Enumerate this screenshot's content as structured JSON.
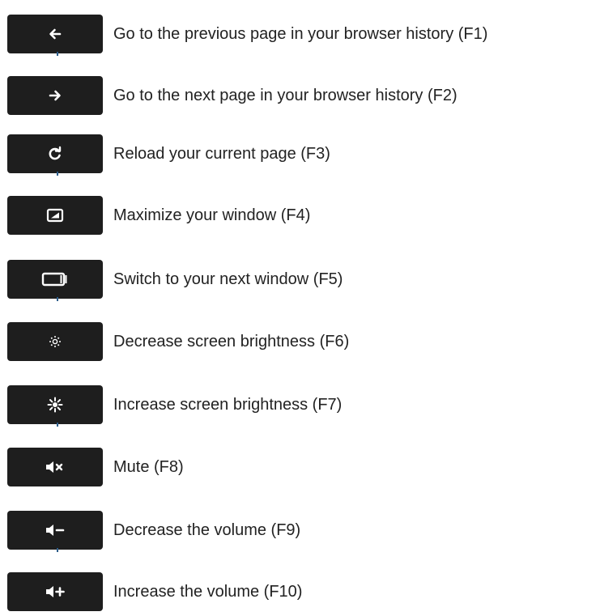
{
  "keys": [
    {
      "icon": "back-arrow-icon",
      "description": "Go to the previous page in your browser history (F1)"
    },
    {
      "icon": "forward-arrow-icon",
      "description": "Go to the next page in your browser history (F2)"
    },
    {
      "icon": "reload-icon",
      "description": "Reload your current page (F3)"
    },
    {
      "icon": "maximize-window-icon",
      "description": "Maximize your window (F4)"
    },
    {
      "icon": "switch-window-icon",
      "description": "Switch to your next window (F5)"
    },
    {
      "icon": "brightness-down-icon",
      "description": "Decrease screen brightness (F6)"
    },
    {
      "icon": "brightness-up-icon",
      "description": "Increase screen brightness (F7)"
    },
    {
      "icon": "mute-icon",
      "description": "Mute (F8)"
    },
    {
      "icon": "volume-down-icon",
      "description": "Decrease the volume (F9)"
    },
    {
      "icon": "volume-up-icon",
      "description": "Increase the volume (F10)"
    }
  ],
  "colors": {
    "key_background": "#1e1e1e",
    "key_icon": "#ffffff",
    "text": "#222222"
  }
}
